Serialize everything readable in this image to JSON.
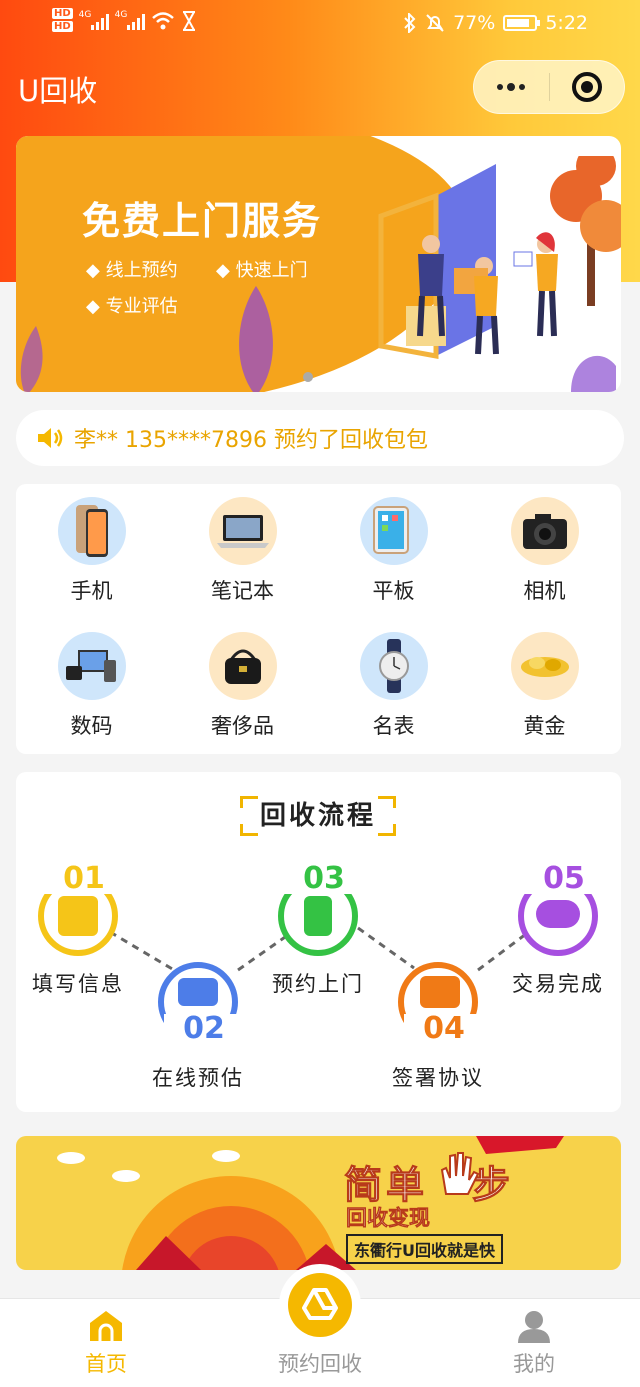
{
  "status_bar": {
    "hd1": "HD",
    "hd2": "HD",
    "net1": "4G",
    "net2": "4G",
    "battery_pct": "77%",
    "time": "5:22"
  },
  "header": {
    "title": "U回收",
    "capsule_icons": [
      "more-dots-icon",
      "close-target-icon"
    ]
  },
  "banner": {
    "headline": "免费上门服务",
    "features": [
      "线上预约",
      "快速上门",
      "专业评估"
    ],
    "page_count": 1
  },
  "notice": {
    "icon": "speaker-icon",
    "text": "李** 135****7896 预约了回收包包"
  },
  "categories": [
    {
      "label": "手机",
      "icon": "phone-icon"
    },
    {
      "label": "笔记本",
      "icon": "laptop-icon"
    },
    {
      "label": "平板",
      "icon": "tablet-icon"
    },
    {
      "label": "相机",
      "icon": "camera-icon"
    },
    {
      "label": "数码",
      "icon": "digital-icon"
    },
    {
      "label": "奢侈品",
      "icon": "handbag-icon"
    },
    {
      "label": "名表",
      "icon": "watch-icon"
    },
    {
      "label": "黄金",
      "icon": "gold-icon"
    }
  ],
  "process": {
    "title": "回收流程",
    "steps": [
      {
        "num": "01",
        "label": "填写信息",
        "color": "#f5c518"
      },
      {
        "num": "02",
        "label": "在线预估",
        "color": "#4d7de8"
      },
      {
        "num": "03",
        "label": "预约上门",
        "color": "#34c244"
      },
      {
        "num": "04",
        "label": "签署协议",
        "color": "#f07a16"
      },
      {
        "num": "05",
        "label": "交易完成",
        "color": "#a64fe0"
      }
    ]
  },
  "promo": {
    "headline_a": "简单",
    "headline_b": "步",
    "sub": "回收变现",
    "tagline": "东衢行U回收就是快"
  },
  "tabbar": {
    "items": [
      {
        "label": "首页",
        "active": true
      },
      {
        "label": "预约回收",
        "active": false
      },
      {
        "label": "我的",
        "active": false
      }
    ],
    "active_color": "#f5b800",
    "inactive_color": "#999999"
  }
}
